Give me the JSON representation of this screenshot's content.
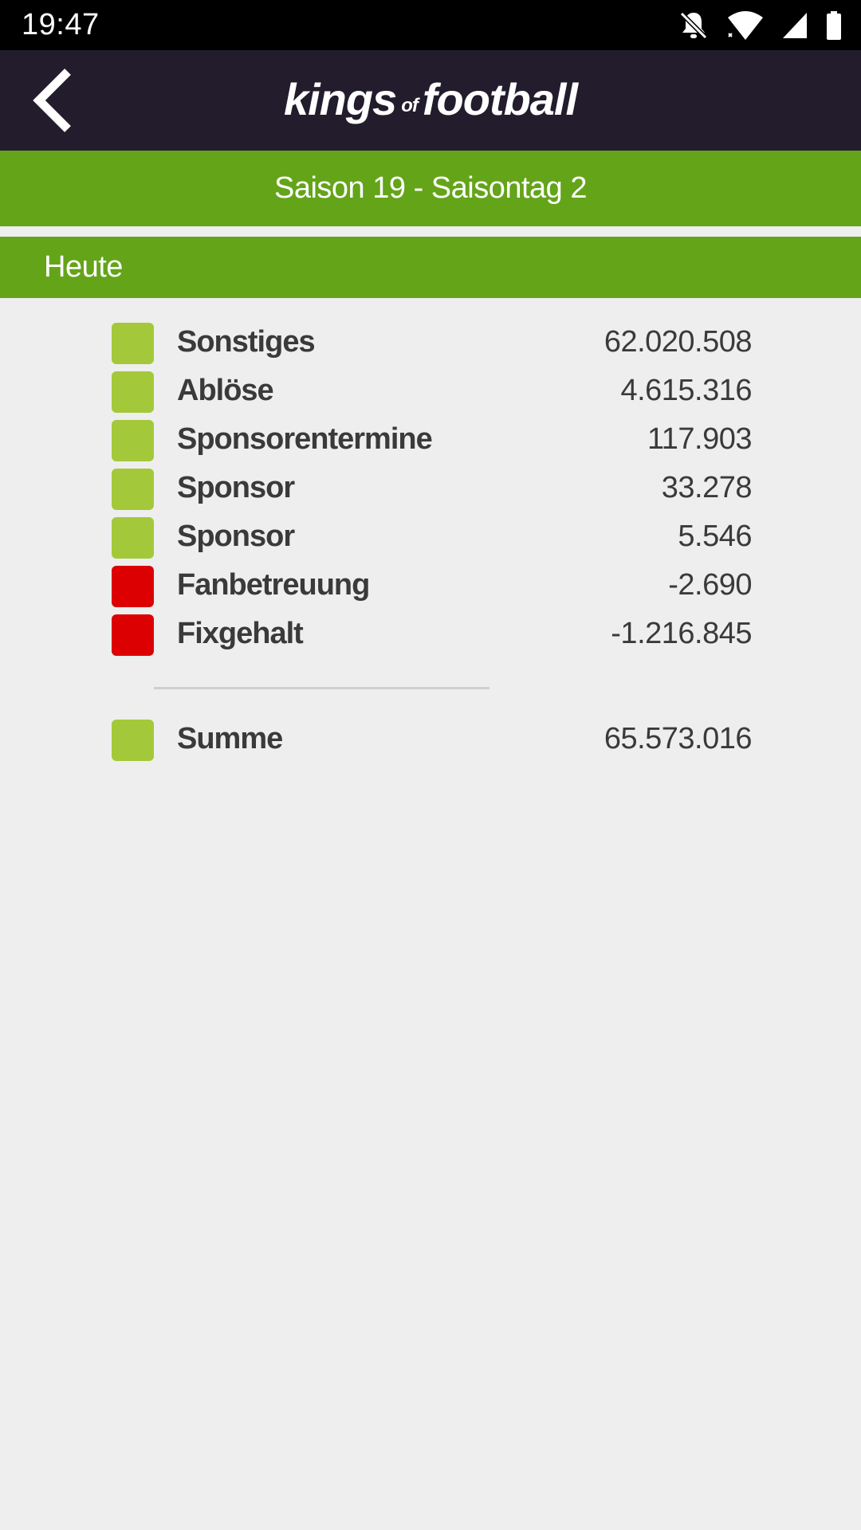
{
  "status_bar": {
    "time": "19:47",
    "icons": [
      "bell-off-icon",
      "wifi-icon",
      "signal-icon",
      "battery-icon"
    ]
  },
  "header": {
    "logo_part1": "kings",
    "logo_part2": "of",
    "logo_part3": "football",
    "back_icon": "chevron-left-icon"
  },
  "season_bar": {
    "text": "Saison 19 - Saisontag 2"
  },
  "section": {
    "title": "Heute"
  },
  "colors": {
    "positive": "#a3c93a",
    "negative": "#dc0003",
    "accent": "#64a419",
    "header_bg": "#231c2c"
  },
  "rows": [
    {
      "label": "Sonstiges",
      "value": "62.020.508",
      "status": "positive"
    },
    {
      "label": "Ablöse",
      "value": "4.615.316",
      "status": "positive"
    },
    {
      "label": "Sponsorentermine",
      "value": "117.903",
      "status": "positive"
    },
    {
      "label": "Sponsor",
      "value": "33.278",
      "status": "positive"
    },
    {
      "label": "Sponsor",
      "value": "5.546",
      "status": "positive"
    },
    {
      "label": "Fanbetreuung",
      "value": "-2.690",
      "status": "negative"
    },
    {
      "label": "Fixgehalt",
      "value": "-1.216.845",
      "status": "negative"
    }
  ],
  "total": {
    "label": "Summe",
    "value": "65.573.016",
    "status": "positive"
  }
}
